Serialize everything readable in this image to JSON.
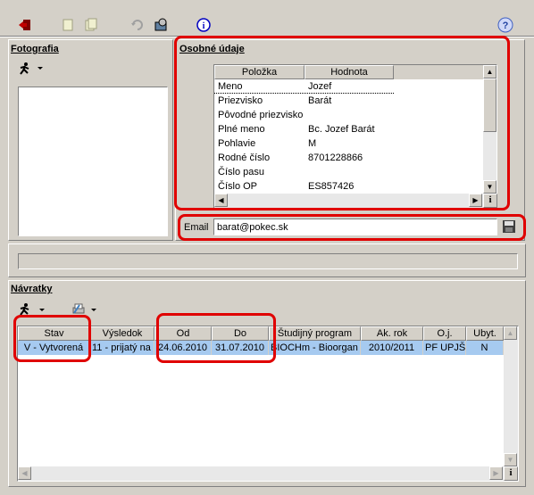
{
  "toolbar": {
    "buttons": [
      "exit-icon",
      "doc-icon",
      "doc-copy-icon",
      "refresh-icon",
      "settings-icon",
      "info-icon"
    ],
    "help_icon": "help-icon"
  },
  "photo": {
    "label": "Fotografia"
  },
  "personal": {
    "label": "Osobné údaje",
    "columns": [
      "Položka",
      "Hodnota"
    ],
    "rows": [
      {
        "key": "Meno",
        "value": "Jozef"
      },
      {
        "key": "Priezvisko",
        "value": "Barát"
      },
      {
        "key": "Pôvodné priezvisko",
        "value": ""
      },
      {
        "key": "Plné meno",
        "value": "Bc. Jozef Barát"
      },
      {
        "key": "Pohlavie",
        "value": "M"
      },
      {
        "key": "Rodné číslo",
        "value": "8701228866"
      },
      {
        "key": "Číslo pasu",
        "value": ""
      },
      {
        "key": "Číslo OP",
        "value": "ES857426"
      }
    ],
    "info_button": "i"
  },
  "email": {
    "label": "Email",
    "value": "barat@pokec.sk"
  },
  "returns": {
    "label": "Návratky",
    "columns": [
      "Stav",
      "Výsledok",
      "Od",
      "Do",
      "Študijný program",
      "Ak. rok",
      "O.j.",
      "Ubyt."
    ],
    "rows": [
      {
        "stav": "V - Vytvorená",
        "vysledok": "11 - prijatý na",
        "od": "24.06.2010",
        "do": "31.07.2010",
        "program": "BIOCHm - Bioorgan",
        "rok": "2010/2011",
        "oj": "PF UPJŠ",
        "ubyt": "N"
      }
    ],
    "info_button": "i"
  },
  "colors": {
    "highlight": "#a6caf0",
    "annotation": "#e00000"
  }
}
